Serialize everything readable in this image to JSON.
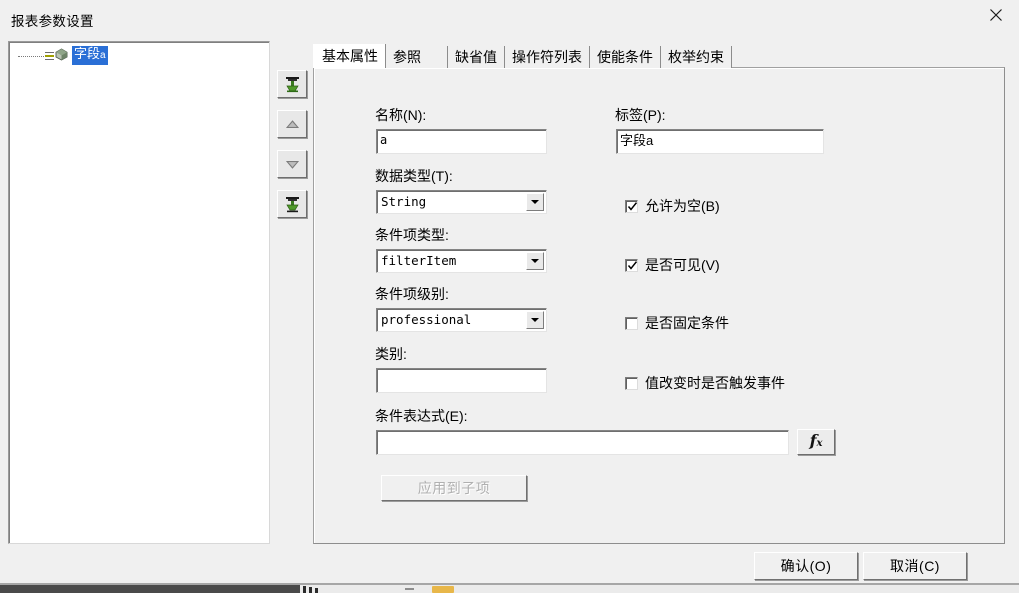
{
  "window": {
    "title": "报表参数设置",
    "close_icon": "close-icon"
  },
  "tree": {
    "items": [
      {
        "label": "字段",
        "suffix": "a",
        "selected": true,
        "icon": "node-icon"
      }
    ]
  },
  "order_toolbar": {
    "buttons": [
      {
        "name": "move-to-top-button",
        "icon": "move-to-top-icon",
        "enabled": true
      },
      {
        "name": "move-up-button",
        "icon": "arrow-up-icon",
        "enabled": false
      },
      {
        "name": "move-down-button",
        "icon": "arrow-down-icon",
        "enabled": false
      },
      {
        "name": "move-to-bottom-button",
        "icon": "move-to-bottom-icon",
        "enabled": true
      }
    ]
  },
  "tabs": [
    {
      "label": "基本属性",
      "active": true
    },
    {
      "label": "参照",
      "active": false
    },
    {
      "label": "缺省值",
      "active": false
    },
    {
      "label": "操作符列表",
      "active": false
    },
    {
      "label": "使能条件",
      "active": false
    },
    {
      "label": "枚举约束",
      "active": false
    }
  ],
  "form": {
    "name": {
      "label": "名称(N):",
      "value": "a",
      "placeholder": ""
    },
    "label_field": {
      "label": "标签(P):",
      "value": "字段a",
      "placeholder": ""
    },
    "data_type": {
      "label": "数据类型(T):",
      "value": "String"
    },
    "filter_item_type": {
      "label": "条件项类型:",
      "value": "filterItem"
    },
    "filter_item_level": {
      "label": "条件项级别:",
      "value": "professional"
    },
    "category": {
      "label": "类别:",
      "value": "",
      "placeholder": ""
    },
    "condition_expression": {
      "label": "条件表达式(E):",
      "value": "",
      "placeholder": ""
    },
    "fx_button": {
      "label": "fx",
      "name": "expression-builder-button"
    },
    "apply_to_children": {
      "label": "应用到子项",
      "enabled": false
    },
    "checkboxes": [
      {
        "label": "允许为空(B)",
        "checked": true,
        "name": "allow-null-checkbox"
      },
      {
        "label": "是否可见(V)",
        "checked": true,
        "name": "visible-checkbox"
      },
      {
        "label": "是否固定条件",
        "checked": false,
        "name": "fixed-condition-checkbox"
      },
      {
        "label": "值改变时是否触发事件",
        "checked": false,
        "name": "trigger-on-change-checkbox"
      }
    ]
  },
  "dialog_buttons": {
    "ok": "确认(O)",
    "cancel": "取消(C)"
  },
  "colors": {
    "dialog_bg": "#f0f0f0",
    "field_bg": "#ffffff",
    "selection_blue": "#2a6fd6",
    "border_dark": "#848484",
    "disabled_text": "#b0b0b0"
  }
}
